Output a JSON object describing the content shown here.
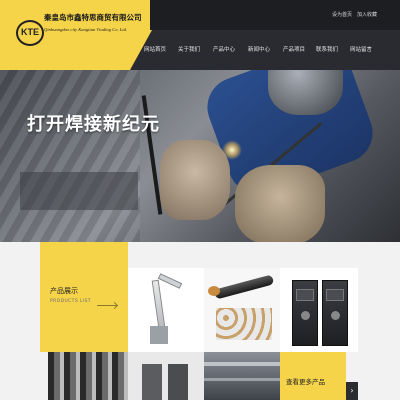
{
  "brand": {
    "logo_text": "KTE",
    "name_cn": "秦皇岛市鑫特思商贸有限公司",
    "name_en": "Qinhuangdao city Kangtian Trading Co. Ltd."
  },
  "topbar": {
    "links": [
      "设为首页",
      "加入收藏"
    ]
  },
  "nav": {
    "items": [
      "网站首页",
      "关于我们",
      "产品中心",
      "新闻中心",
      "产品项目",
      "联系我们",
      "网站留言"
    ]
  },
  "hero": {
    "title": "打开焊接新纪元"
  },
  "products": {
    "title": "产品展示",
    "subtitle": "PRODUCTS LIST",
    "more_label": "查看更多产品",
    "more_arrow": "›"
  },
  "colors": {
    "accent": "#f5d44a",
    "dark": "#1d1e22"
  }
}
